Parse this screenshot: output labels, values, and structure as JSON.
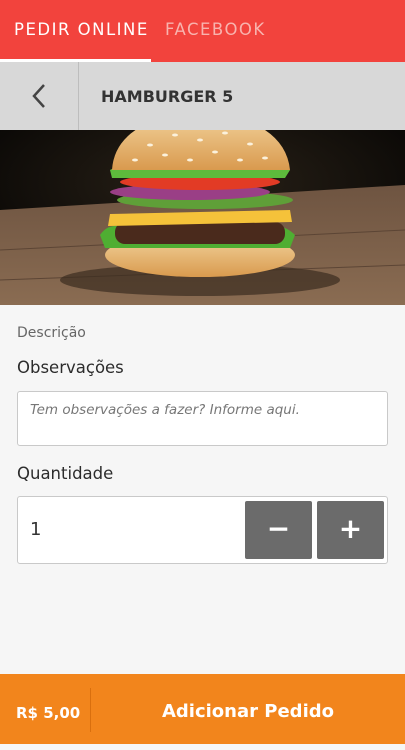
{
  "tabs": {
    "active": "PEDIR ONLINE",
    "inactive": "FACEBOOK"
  },
  "header": {
    "title": "HAMBURGER 5"
  },
  "form": {
    "description_label": "Descrição",
    "notes_label": "Observações",
    "notes_placeholder": "Tem observações a fazer?  Informe aqui.",
    "quantity_label": "Quantidade",
    "quantity_value": "1",
    "minus_label": "−",
    "plus_label": "+"
  },
  "footer": {
    "price": "R$ 5,00",
    "add_label": "Adicionar Pedido"
  },
  "colors": {
    "tab_bar": "#f2433d",
    "footer": "#f2851c",
    "stepper": "#6b6b6b"
  }
}
